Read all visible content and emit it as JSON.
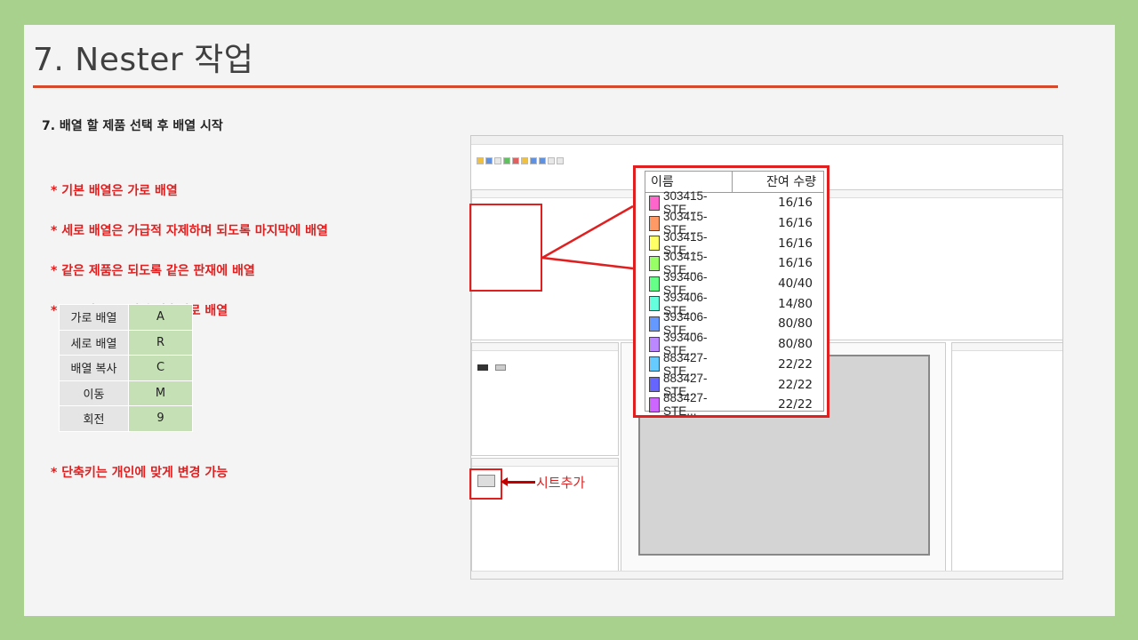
{
  "slide": {
    "title": "7. Nester 작업",
    "heading": "7.  배열 할 제품 선택 후 배열 시작",
    "bullets": [
      "* 기본 배열은 가로 배열",
      "* 세로 배열은 가급적 자제하며 되도록 마지막에 배열",
      "* 같은 제품은 되도록 같은 판재에 배열",
      "* 도구바 또는 배열 단축키로 배열"
    ],
    "shortcuts": [
      {
        "key": "가로 배열",
        "value": "A"
      },
      {
        "key": "세로 배열",
        "value": "R"
      },
      {
        "key": "배열 복사",
        "value": "C"
      },
      {
        "key": "이동",
        "value": "M"
      },
      {
        "key": "회전",
        "value": "9"
      }
    ],
    "footnote": "* 단축키는 개인에 맞게 변경 가능",
    "callout_add_sheet": "시트추가"
  },
  "zoom_table": {
    "col_name": "이름",
    "col_qty": "잔여 수량",
    "rows": [
      {
        "name": "303415-STE...",
        "qty": "16/16",
        "color": "#ff66cc"
      },
      {
        "name": "303415-STE...",
        "qty": "16/16",
        "color": "#ff9966"
      },
      {
        "name": "303415-STE...",
        "qty": "16/16",
        "color": "#ffff66"
      },
      {
        "name": "303415-STE...",
        "qty": "16/16",
        "color": "#99ff66"
      },
      {
        "name": "393406-STE...",
        "qty": "40/40",
        "color": "#66ff88"
      },
      {
        "name": "393406-STE...",
        "qty": "14/80",
        "color": "#66ffdd"
      },
      {
        "name": "393406-STE...",
        "qty": "80/80",
        "color": "#6699ff"
      },
      {
        "name": "393406-STE...",
        "qty": "80/80",
        "color": "#bb88ff"
      },
      {
        "name": "883427-STE...",
        "qty": "22/22",
        "color": "#66ccff"
      },
      {
        "name": "883427-STE...",
        "qty": "22/22",
        "color": "#6666ff"
      },
      {
        "name": "883427-STE...",
        "qty": "22/22",
        "color": "#cc66ff"
      }
    ]
  }
}
